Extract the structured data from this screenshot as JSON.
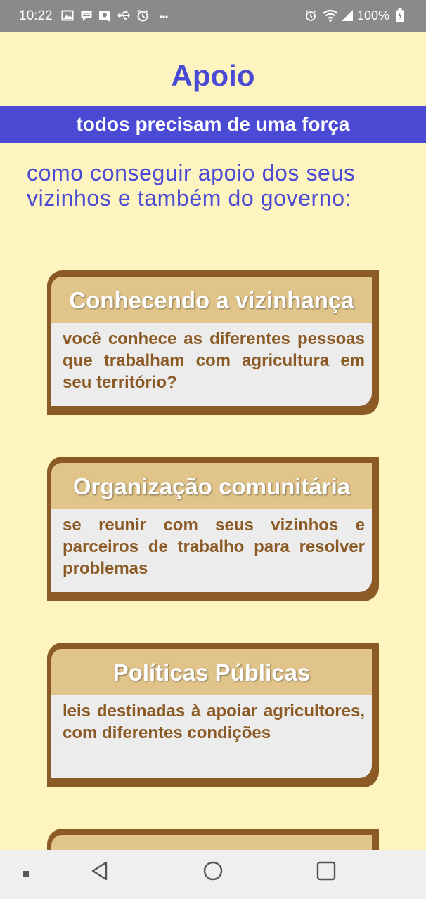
{
  "status_bar": {
    "time": "10:22",
    "battery": "100%",
    "notification_icons": [
      "gallery-icon",
      "message-icon",
      "sim-icon",
      "usb-icon",
      "alarm-clock-icon",
      "more-icon"
    ],
    "system_icons": [
      "alarm-icon",
      "wifi-icon",
      "signal-icon",
      "battery-icon"
    ]
  },
  "header": {
    "title": "Apoio",
    "subtitle": "todos precisam de uma força",
    "intro": "como conseguir apoio dos seus vizinhos e também do governo:"
  },
  "cards": [
    {
      "title": "Conhecendo a vizinhança",
      "body": "você conhece as diferentes pessoas que trabalham com agricultura em seu território?"
    },
    {
      "title": "Organização comunitária",
      "body": "se reunir com seus vizinhos e parceiros de trabalho para resolver problemas"
    },
    {
      "title": "Políticas Públicas",
      "body": "leis destinadas à apoiar agricultores, com diferentes condições"
    }
  ],
  "nav_bar": {
    "buttons": [
      "menu-icon",
      "back-icon",
      "home-icon",
      "recents-icon"
    ]
  },
  "colors": {
    "background": "#fdf4c0",
    "accent": "#4b4ad4",
    "card_frame": "#8b5a25",
    "card_title_bg": "#e0c48a",
    "card_body_bg": "#ececec",
    "status_bar": "#8a8a8a",
    "nav_bar": "#efefef"
  }
}
